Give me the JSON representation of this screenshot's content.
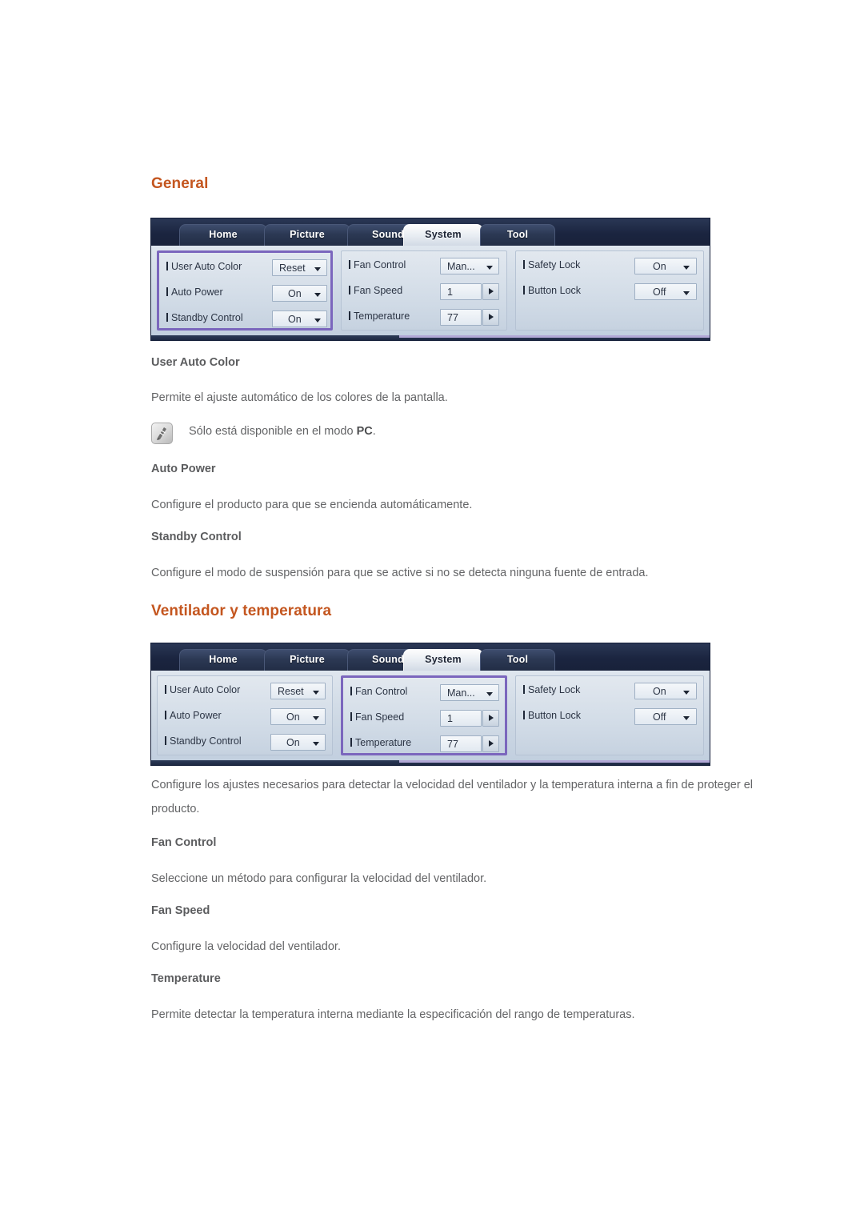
{
  "page": {
    "sections": [
      {
        "heading": "General",
        "blocks": [
          {
            "type": "sub",
            "text": "User Auto Color"
          },
          {
            "type": "body",
            "text": "Permite el ajuste automático de los colores de la pantalla."
          },
          {
            "type": "note",
            "text_before": "Sólo está disponible en el modo ",
            "bold": "PC",
            "text_after": ".",
            "icon": "note-pencil-icon"
          },
          {
            "type": "sub",
            "text": "Auto Power"
          },
          {
            "type": "body",
            "text": "Configure el producto para que se encienda automáticamente."
          },
          {
            "type": "sub",
            "text": "Standby Control"
          },
          {
            "type": "body",
            "text": "Configure el modo de suspensión para que se active si no se detecta ninguna fuente de entrada."
          }
        ]
      },
      {
        "heading": "Ventilador y temperatura",
        "blocks": [
          {
            "type": "body",
            "text": "Configure los ajustes necesarios para detectar la velocidad del ventilador y la temperatura interna a fin de proteger el producto."
          },
          {
            "type": "sub",
            "text": "Fan Control"
          },
          {
            "type": "body",
            "text": "Seleccione un método para configurar la velocidad del ventilador."
          },
          {
            "type": "sub",
            "text": "Fan Speed"
          },
          {
            "type": "body",
            "text": "Configure la velocidad del ventilador."
          },
          {
            "type": "sub",
            "text": "Temperature"
          },
          {
            "type": "body",
            "text": "Permite detectar la temperatura interna mediante la especificación del rango de temperaturas."
          }
        ]
      }
    ]
  },
  "osd": {
    "tabs": [
      {
        "label": "Home",
        "active": false
      },
      {
        "label": "Picture",
        "active": false
      },
      {
        "label": "Sound",
        "active": false
      },
      {
        "label": "System",
        "active": true
      },
      {
        "label": "Tool",
        "active": false
      }
    ],
    "columns": [
      {
        "name": "general-column",
        "rows": [
          {
            "label": "User Auto Color",
            "value": "Reset",
            "control": "dropdown"
          },
          {
            "label": "Auto Power",
            "value": "On",
            "control": "dropdown"
          },
          {
            "label": "Standby Control",
            "value": "On",
            "control": "dropdown"
          }
        ]
      },
      {
        "name": "fan-temperature-column",
        "rows": [
          {
            "label": "Fan Control",
            "value": "Man...",
            "control": "dropdown"
          },
          {
            "label": "Fan Speed",
            "value": "1",
            "control": "spinner"
          },
          {
            "label": "Temperature",
            "value": "77",
            "control": "spinner"
          }
        ]
      },
      {
        "name": "lock-column",
        "rows": [
          {
            "label": "Safety Lock",
            "value": "On",
            "control": "dropdown"
          },
          {
            "label": "Button Lock",
            "value": "Off",
            "control": "dropdown"
          }
        ]
      }
    ],
    "highlight": {
      "first_screenshot_column": "general-column",
      "second_screenshot_column": "fan-temperature-column",
      "color": "#7b66bd"
    }
  },
  "colors": {
    "heading": "#c4561f",
    "body_text": "#636466",
    "osd_bar": "#1f2b45",
    "osd_panel": "#cdd8e4",
    "highlight": "#7b66bd"
  }
}
